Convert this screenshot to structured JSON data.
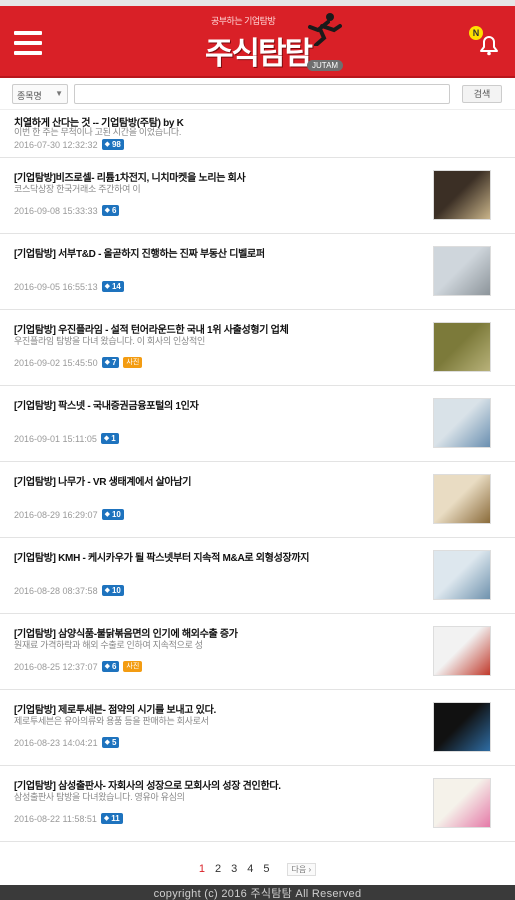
{
  "header": {
    "logo_small": "공부하는 기업탐방",
    "logo_main": "주식탐탐",
    "logo_sub": "JUTAM",
    "notification_badge": "N",
    "brand_color": "#d92027"
  },
  "search": {
    "select_value": "종목명",
    "input_value": "",
    "button_label": "검색"
  },
  "items": [
    {
      "title": "치열하게 산다는 것 -- 기업탐방(주탐) by K",
      "summary": "이번 한 주는 무척이나 고된 시간을 이었습니다.",
      "date": "2016-07-30 12:32:32",
      "comments": "98",
      "photo_badge": "",
      "thumb": false
    },
    {
      "title": "[기업탐방]비즈로셀- 리튬1차전지, 니치마켓을 노리는 회사",
      "summary": "코스닥상장 한국거래소 주간하여 이",
      "date": "2016-09-08 15:33:33",
      "comments": "6",
      "photo_badge": "",
      "thumb": true
    },
    {
      "title": "[기업탐방] 서부T&D - 올곧하지 진행하는 진짜 부동산 디벨로퍼",
      "summary": "",
      "date": "2016-09-05 16:55:13",
      "comments": "14",
      "photo_badge": "",
      "thumb": true
    },
    {
      "title": "[기업탐방] 우진플라임 - 설적 턴어라운드한 국내 1위 사출성형기 업체",
      "summary": "우진플라임 탐방을 다녀 왔습니다. 이 회사의 인상적인",
      "date": "2016-09-02 15:45:50",
      "comments": "7",
      "photo_badge": "사진",
      "thumb": true
    },
    {
      "title": "[기업탐방] 팍스넷 - 국내증권금융포털의 1인자",
      "summary": "",
      "date": "2016-09-01 15:11:05",
      "comments": "1",
      "photo_badge": "",
      "thumb": true
    },
    {
      "title": "[기업탐방] 나무가 - VR 생태계에서 살아남기",
      "summary": "",
      "date": "2016-08-29 16:29:07",
      "comments": "10",
      "photo_badge": "",
      "thumb": true
    },
    {
      "title": "[기업탐방] KMH - 케시카우가 될 팍스넷부터 지속적 M&A로 외형성장까지",
      "summary": "",
      "date": "2016-08-28 08:37:58",
      "comments": "10",
      "photo_badge": "",
      "thumb": true
    },
    {
      "title": "[기업탐방] 삼양식품-불닭볶음면의 인기에 해외수출 증가",
      "summary": "원재료 가격하락과 해외 수출로 인하여 지속적으로 성",
      "date": "2016-08-25 12:37:07",
      "comments": "6",
      "photo_badge": "사진",
      "thumb": true
    },
    {
      "title": "[기업탐방] 제로투세븐- 점약의 시기를 보내고 있다.",
      "summary": "제로투세븐은 유아의류와 용품 등을 판매하는 회사로서",
      "date": "2016-08-23 14:04:21",
      "comments": "5",
      "photo_badge": "",
      "thumb": true
    },
    {
      "title": "[기업탐방] 삼성출판사- 자회사의 성장으로 모회사의 성장 견인한다.",
      "summary": "삼성출판사 탐방을 다녀왔습니다. 영유아 유심의",
      "date": "2016-08-22 11:58:51",
      "comments": "11",
      "photo_badge": "",
      "thumb": true
    }
  ],
  "pagination": {
    "pages": [
      "1",
      "2",
      "3",
      "4",
      "5"
    ],
    "active": "1",
    "next_label": "다음 ›"
  },
  "footer": {
    "copyright": "copyright (c) 2016 주식탐탐 All Reserved"
  }
}
